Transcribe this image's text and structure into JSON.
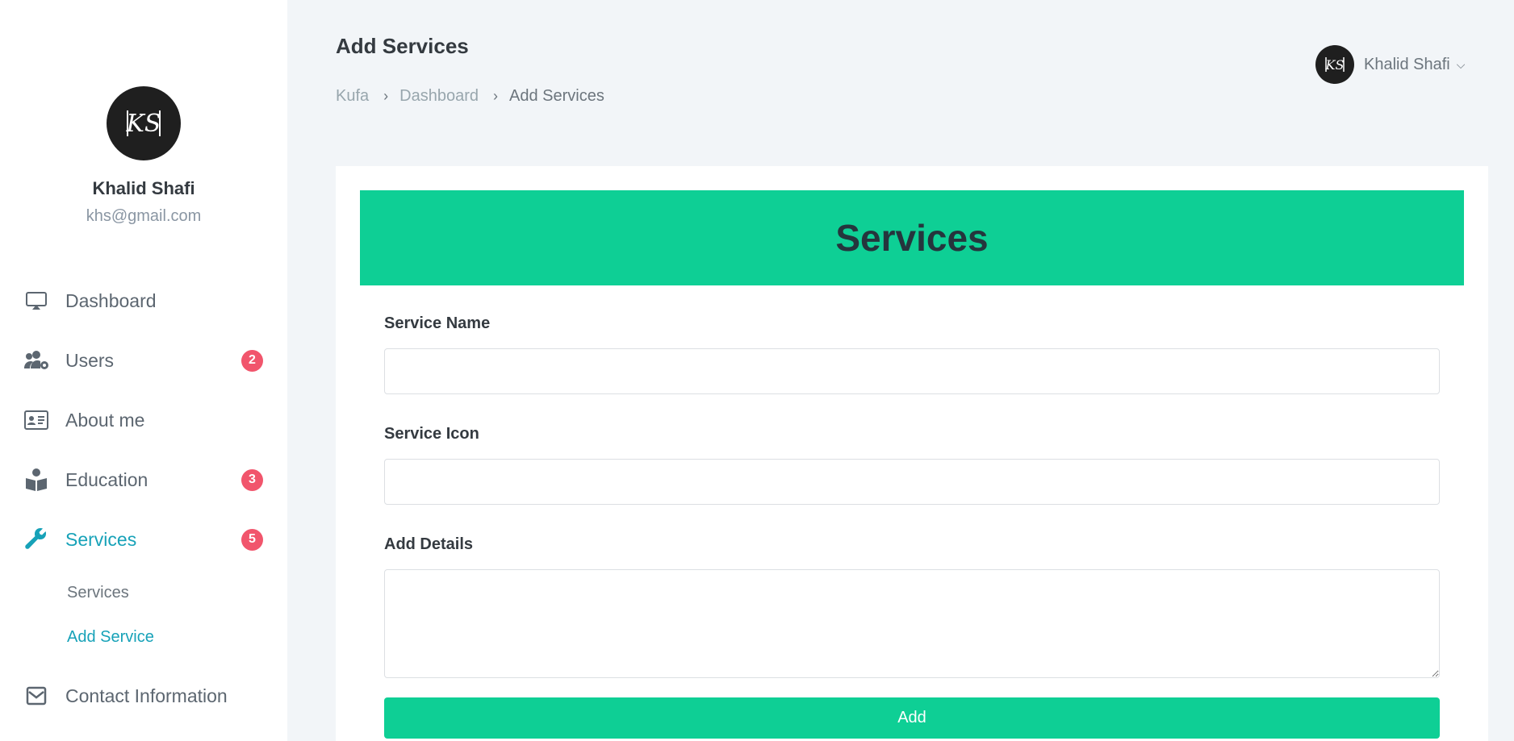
{
  "profile": {
    "name": "Khalid Shafi",
    "email": "khs@gmail.com",
    "avatar_initials": "KS"
  },
  "sidebar": {
    "items": [
      {
        "label": "Dashboard",
        "icon": "monitor-icon",
        "badge": ""
      },
      {
        "label": "Users",
        "icon": "users-cog-icon",
        "badge": "2"
      },
      {
        "label": "About me",
        "icon": "id-card-icon",
        "badge": ""
      },
      {
        "label": "Education",
        "icon": "reader-icon",
        "badge": "3"
      },
      {
        "label": "Services",
        "icon": "wrench-icon",
        "badge": "5",
        "active": true
      },
      {
        "label": "Contact Information",
        "icon": "envelope-icon",
        "badge": ""
      }
    ],
    "services_sub": [
      {
        "label": "Services"
      },
      {
        "label": "Add Service",
        "active": true
      }
    ]
  },
  "header": {
    "title": "Add Services",
    "breadcrumb": [
      "Kufa",
      "Dashboard",
      "Add Services"
    ],
    "user_name": "Khalid Shafi"
  },
  "card": {
    "banner_title": "Services",
    "fields": {
      "service_name_label": "Service Name",
      "service_name_value": "",
      "service_icon_label": "Service Icon",
      "service_icon_value": "",
      "details_label": "Add Details",
      "details_value": ""
    },
    "submit_label": "Add"
  },
  "colors": {
    "accent": "#0ecf95",
    "active_nav": "#17a2b8",
    "badge": "#f1556c",
    "background": "#f2f5f8"
  }
}
